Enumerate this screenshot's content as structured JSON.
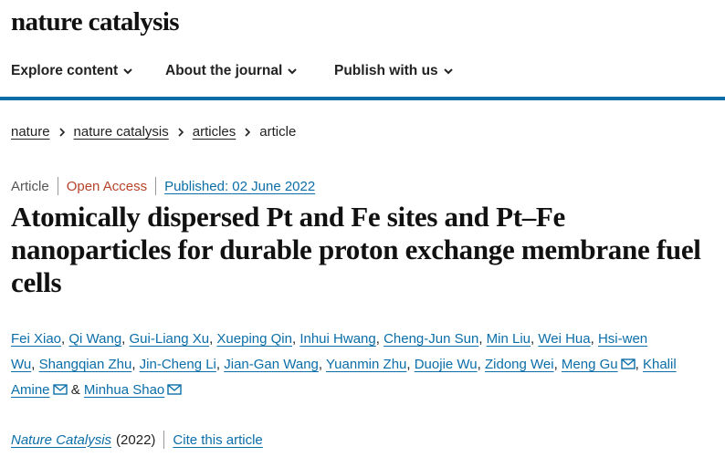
{
  "masthead": {
    "logo_text": "nature catalysis"
  },
  "nav": {
    "items": [
      {
        "label": "Explore content"
      },
      {
        "label": "About the journal"
      },
      {
        "label": "Publish with us"
      }
    ]
  },
  "breadcrumb": {
    "items": [
      {
        "label": "nature"
      },
      {
        "label": "nature catalysis"
      },
      {
        "label": "articles"
      }
    ],
    "current": "article"
  },
  "article": {
    "type": "Article",
    "access": "Open Access",
    "published": "Published: 02 June 2022",
    "title": "Atomically dispersed Pt and Fe sites and Pt–Fe nanoparticles for durable proton exchange membrane fuel cells",
    "authors": [
      {
        "name": "Fei Xiao",
        "sep": ", "
      },
      {
        "name": "Qi Wang",
        "sep": ", "
      },
      {
        "name": "Gui-Liang Xu",
        "sep": ", "
      },
      {
        "name": "Xueping Qin",
        "sep": ", "
      },
      {
        "name": "Inhui Hwang",
        "sep": ", "
      },
      {
        "name": "Cheng-Jun Sun",
        "sep": ", "
      },
      {
        "name": "Min Liu",
        "sep": ", "
      },
      {
        "name": "Wei Hua",
        "sep": ", "
      },
      {
        "name": "Hsi-wen Wu",
        "sep": ", "
      },
      {
        "name": "Shangqian Zhu",
        "sep": ", "
      },
      {
        "name": "Jin-Cheng Li",
        "sep": ", "
      },
      {
        "name": "Jian-Gan Wang",
        "sep": ", "
      },
      {
        "name": "Yuanmin Zhu",
        "sep": ", "
      },
      {
        "name": "Duojie Wu",
        "sep": ", "
      },
      {
        "name": "Zidong Wei",
        "sep": ", "
      },
      {
        "name": "Meng Gu",
        "sep": ", ",
        "email": true
      },
      {
        "name": "Khalil Amine",
        "sep": " & ",
        "email": true
      },
      {
        "name": "Minhua Shao",
        "sep": "",
        "email": true
      }
    ],
    "journal": "Nature Catalysis",
    "year": "(2022)",
    "cite_label": "Cite this article"
  },
  "colors": {
    "accent_blue": "#0b6ea8",
    "open_access": "#b6442a",
    "text": "#222222"
  },
  "icons": {
    "nav_dropdown": "chevron-down-icon",
    "breadcrumb_separator": "chevron-right-icon",
    "author_email": "envelope-icon"
  }
}
